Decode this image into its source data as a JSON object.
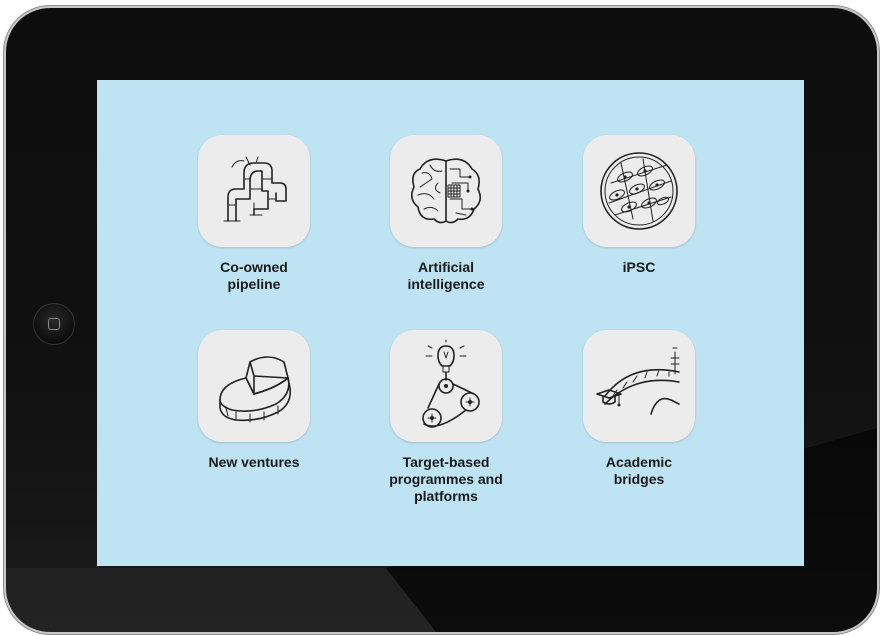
{
  "screen": {
    "apps": [
      {
        "label": "Co-owned\npipeline",
        "icon": "pipeline-icon"
      },
      {
        "label": "Artificial\nintelligence",
        "icon": "brain-circuit-icon"
      },
      {
        "label": "iPSC",
        "icon": "cell-culture-icon"
      },
      {
        "label": "New ventures",
        "icon": "pie-slice-icon"
      },
      {
        "label": "Target-based\nprogrammes and\nplatforms",
        "icon": "lightbulb-gears-icon"
      },
      {
        "label": "Academic\nbridges",
        "icon": "bridge-graduation-icon"
      }
    ]
  },
  "colors": {
    "screen_background": "#bee3f3",
    "tile_background": "#ececec",
    "bezel": "#111111",
    "label_text": "#1a1a1a"
  }
}
